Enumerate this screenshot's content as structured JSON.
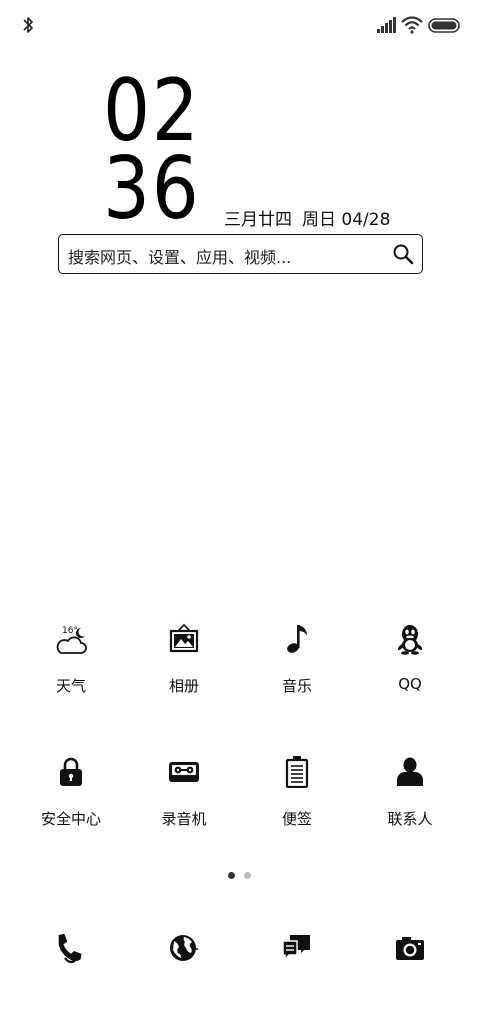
{
  "status_bar": {
    "left_icons": [
      "bluetooth-icon"
    ],
    "right_icons": [
      "cellular-signal-icon",
      "wifi-icon",
      "battery-icon"
    ]
  },
  "clock": {
    "hours": "02",
    "minutes": "36",
    "lunar_date": "三月廿四",
    "weekday_date": "周日 04/28"
  },
  "search": {
    "placeholder": "搜索网页、设置、应用、视频..."
  },
  "apps": [
    {
      "label": "天气",
      "icon": "weather-icon",
      "temp": "16°"
    },
    {
      "label": "相册",
      "icon": "gallery-icon"
    },
    {
      "label": "音乐",
      "icon": "music-icon"
    },
    {
      "label": "QQ",
      "icon": "qq-icon"
    },
    {
      "label": "安全中心",
      "icon": "security-lock-icon"
    },
    {
      "label": "录音机",
      "icon": "recorder-icon"
    },
    {
      "label": "便签",
      "icon": "notes-icon"
    },
    {
      "label": "联系人",
      "icon": "contacts-icon"
    }
  ],
  "page_indicator": {
    "current": 1,
    "total": 2
  },
  "dock": [
    "phone-icon",
    "browser-icon",
    "messages-icon",
    "camera-icon"
  ],
  "colors": {
    "background": "#ffffff",
    "foreground": "#000000"
  }
}
